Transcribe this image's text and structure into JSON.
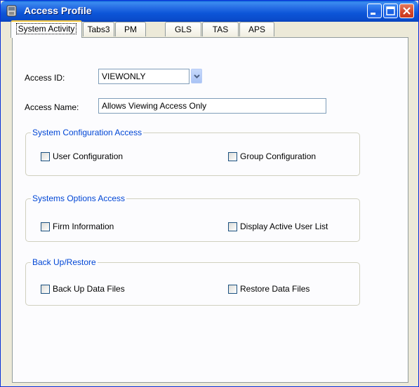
{
  "window": {
    "title": "Access Profile"
  },
  "tabs": [
    "System Activity",
    "Tabs3",
    "PM",
    "GLS",
    "TAS",
    "APS"
  ],
  "form": {
    "access_id_label": "Access ID:",
    "access_id_value": "VIEWONLY",
    "access_name_label": "Access Name:",
    "access_name_value": "Allows Viewing Access Only"
  },
  "groups": [
    {
      "title": "System Configuration Access",
      "options": [
        {
          "label": "User Configuration",
          "checked": false
        },
        {
          "label": "Group Configuration",
          "checked": false
        }
      ]
    },
    {
      "title": "Systems Options Access",
      "options": [
        {
          "label": "Firm Information",
          "checked": false
        },
        {
          "label": "Display Active User List",
          "checked": false
        }
      ]
    },
    {
      "title": "Back Up/Restore",
      "options": [
        {
          "label": "Back Up Data Files",
          "checked": false
        },
        {
          "label": "Restore Data Files",
          "checked": false
        }
      ]
    }
  ],
  "colors": {
    "titlebar": "#0a4ccb",
    "group_title": "#0046d5",
    "window_bg": "#ece9d8",
    "panel_bg": "#fcfcfe",
    "active_tab_accent": "#ffc83c"
  },
  "icons": [
    "app-icon",
    "minimize-icon",
    "maximize-icon",
    "close-icon",
    "chevron-down-icon"
  ]
}
